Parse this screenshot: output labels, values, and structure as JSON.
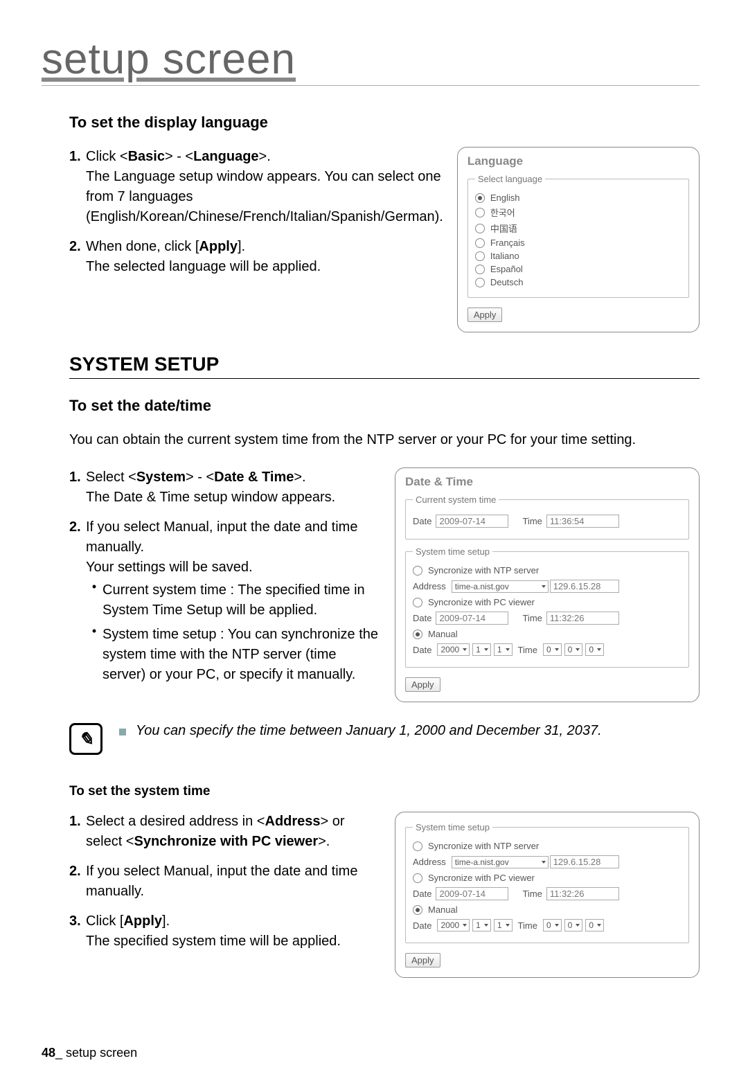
{
  "pageTitle": "setup screen",
  "footer": {
    "pageNum": "48",
    "label": "_ setup screen"
  },
  "langSection": {
    "heading": "To set the display language",
    "steps": [
      {
        "num": "1.",
        "pre": "Click <",
        "b1": "Basic",
        "mid": "> - <",
        "b2": "Language",
        "post": ">.",
        "rest": "The Language setup window appears. You can select one from 7 languages (English/Korean/Chinese/French/Italian/Spanish/German)."
      },
      {
        "num": "2.",
        "pre": "When done, click [",
        "b1": "Apply",
        "post": "].",
        "rest": "The selected language will be applied."
      }
    ],
    "panel": {
      "title": "Language",
      "legend": "Select language",
      "options": [
        "English",
        "한국어",
        "中国语",
        "Français",
        "Italiano",
        "Español",
        "Deutsch"
      ],
      "selectedIndex": 0,
      "apply": "Apply"
    }
  },
  "systemSetupHeading": "SYSTEM SETUP",
  "dateSection": {
    "heading": "To set the date/time",
    "intro": "You can obtain the current system time from the NTP server or your PC for your time setting.",
    "steps": [
      {
        "num": "1.",
        "pre": "Select <",
        "b1": "System",
        "mid": "> - <",
        "b2": "Date & Time",
        "post": ">.",
        "rest": "The Date & Time setup window appears."
      },
      {
        "num": "2.",
        "pre": "If you select Manual, input the date and time manually.",
        "rest": "Your settings will be saved."
      }
    ],
    "bullets": [
      "Current system time : The specified time in System Time Setup will be applied.",
      "System time setup : You can synchronize the system time with the NTP server (time server) or your PC, or specify it manually."
    ],
    "panel": {
      "title": "Date & Time",
      "legend1": "Current system time",
      "dateLabel": "Date",
      "timeLabel": "Time",
      "curDate": "2009-07-14",
      "curTime": "11:36:54",
      "legend2": "System time setup",
      "ntpLabel": "Syncronize with NTP server",
      "addrLabel": "Address",
      "addrVal": "time-a.nist.gov",
      "addrIp": "129.6.15.28",
      "pcLabel": "Syncronize with PC viewer",
      "pcDate": "2009-07-14",
      "pcTime": "11:32:26",
      "manualLabel": "Manual",
      "manDate": [
        "2000",
        "1",
        "1"
      ],
      "manTime": [
        "0",
        "0",
        "0"
      ],
      "apply": "Apply"
    }
  },
  "note": "You can specify the time between January 1, 2000 and December 31, 2037.",
  "sysTimeSection": {
    "heading": "To set the system time",
    "steps": [
      {
        "num": "1.",
        "pre": "Select a desired address in <",
        "b1": "Address",
        "mid": "> or select <",
        "b2": "Synchronize with PC viewer",
        "post": ">."
      },
      {
        "num": "2.",
        "pre": "If you select Manual, input the date and time manually."
      },
      {
        "num": "3.",
        "pre": "Click [",
        "b1": "Apply",
        "post": "].",
        "rest": "The specified system time will be applied."
      }
    ]
  }
}
